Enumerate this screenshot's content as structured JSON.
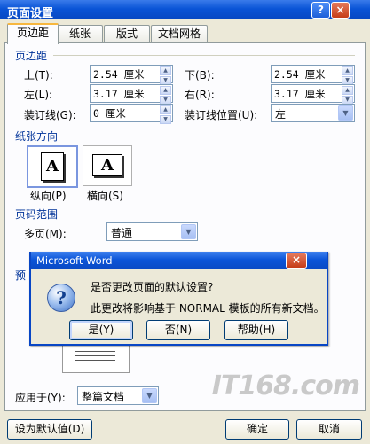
{
  "window": {
    "title": "页面设置",
    "buttons": [
      "?",
      "×"
    ]
  },
  "tabs": [
    {
      "label": "页边距",
      "active": true
    },
    {
      "label": "纸张",
      "active": false
    },
    {
      "label": "版式",
      "active": false
    },
    {
      "label": "文档网格",
      "active": false
    }
  ],
  "margins": {
    "section": "页边距",
    "top_label": "上(T):",
    "top_value": "2.54 厘米",
    "bottom_label": "下(B):",
    "bottom_value": "2.54 厘米",
    "left_label": "左(L):",
    "left_value": "3.17 厘米",
    "right_label": "右(R):",
    "right_value": "3.17 厘米",
    "gutter_label": "装订线(G):",
    "gutter_value": "0 厘米",
    "gutter_pos_label": "装订线位置(U):",
    "gutter_pos_value": "左"
  },
  "orientation": {
    "section": "纸张方向",
    "portrait_label": "纵向(P)",
    "landscape_label": "横向(S)",
    "glyph": "A"
  },
  "pages": {
    "section": "页码范围",
    "multi_label": "多页(M):",
    "multi_value": "普通"
  },
  "preview": {
    "section_fragment": "预"
  },
  "apply": {
    "label": "应用于(Y):",
    "value": "整篇文档"
  },
  "footer": {
    "default_button": "设为默认值(D)",
    "ok_button": "确定",
    "cancel_button": "取消"
  },
  "message_box": {
    "title": "Microsoft Word",
    "question": "是否更改页面的默认设置?",
    "detail": "此更改将影响基于 NORMAL 模板的所有新文档。",
    "icon": "?",
    "yes": "是(Y)",
    "no": "否(N)",
    "help": "帮助(H)"
  },
  "watermark": "IT168.com"
}
